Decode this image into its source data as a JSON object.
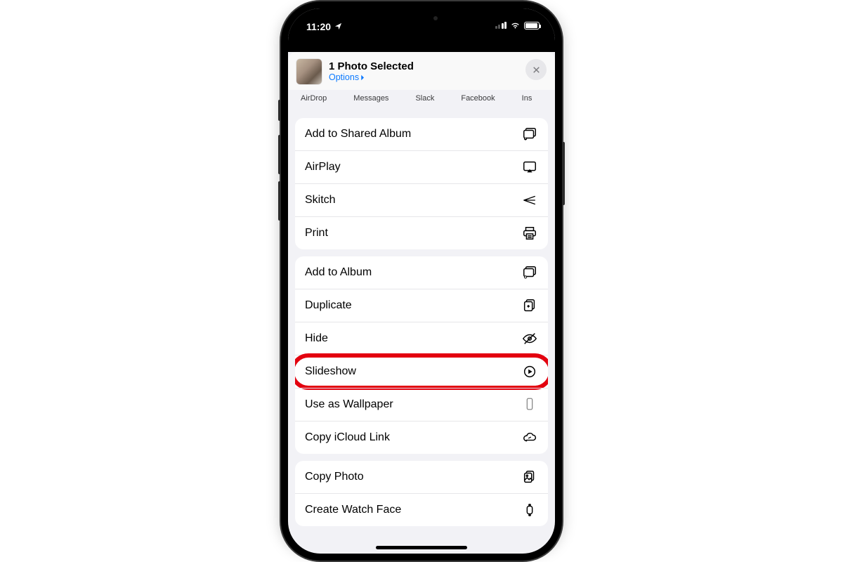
{
  "status": {
    "time": "11:20",
    "location_icon": "location-arrow"
  },
  "header": {
    "title": "1 Photo Selected",
    "options_label": "Options"
  },
  "share_targets": [
    "AirDrop",
    "Messages",
    "Slack",
    "Facebook",
    "Ins"
  ],
  "sections": [
    {
      "rows": [
        {
          "label": "Add to Shared Album",
          "icon": "shared-album-icon"
        },
        {
          "label": "AirPlay",
          "icon": "airplay-icon"
        },
        {
          "label": "Skitch",
          "icon": "skitch-icon"
        },
        {
          "label": "Print",
          "icon": "print-icon"
        }
      ]
    },
    {
      "rows": [
        {
          "label": "Add to Album",
          "icon": "add-album-icon"
        },
        {
          "label": "Duplicate",
          "icon": "duplicate-icon"
        },
        {
          "label": "Hide",
          "icon": "hide-icon"
        },
        {
          "label": "Slideshow",
          "icon": "play-icon",
          "highlighted": true
        },
        {
          "label": "Use as Wallpaper",
          "icon": "wallpaper-icon"
        },
        {
          "label": "Copy iCloud Link",
          "icon": "cloud-link-icon"
        }
      ]
    },
    {
      "rows": [
        {
          "label": "Copy Photo",
          "icon": "copy-photo-icon"
        },
        {
          "label": "Create Watch Face",
          "icon": "watch-icon"
        }
      ]
    }
  ],
  "annotation": {
    "highlight_color": "#e3000f",
    "highlighted_item": "Slideshow"
  }
}
